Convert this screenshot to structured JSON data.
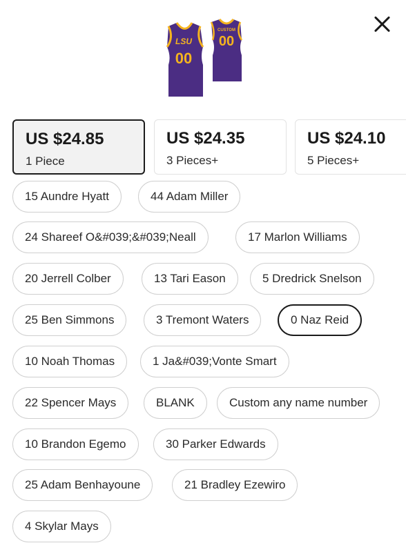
{
  "product": {
    "image_icon": "jersey-image",
    "jersey_number": "00",
    "back_text": "CUSTOM",
    "front_text": "LSU"
  },
  "pricing": [
    {
      "price": "US $24.85",
      "qty": "1 Piece",
      "selected": true
    },
    {
      "price": "US $24.35",
      "qty": "3 Pieces+",
      "selected": false
    },
    {
      "price": "US $24.10",
      "qty": "5 Pieces+",
      "selected": false
    }
  ],
  "options": [
    "15 Aundre Hyatt",
    "44 Adam Miller",
    "24 Shareef O&#039;&#039;Neall",
    "17 Marlon Williams",
    "20 Jerrell Colber",
    "13 Tari Eason",
    "5 Dredrick Snelson",
    "25 Ben Simmons",
    "3 Tremont Waters",
    "0 Naz Reid",
    "10 Noah Thomas",
    "1 Ja&#039;Vonte Smart",
    "22 Spencer Mays",
    "BLANK",
    "Custom any name number",
    "10 Brandon Egemo",
    "30 Parker Edwards",
    "25 Adam Benhayoune",
    "21 Bradley Ezewiro",
    "4 Skylar Mays"
  ],
  "selected_option": "0 Naz Reid",
  "colors": {
    "jersey_purple": "#4b2d83",
    "jersey_gold": "#f5b41e",
    "selected_border": "#1a1a1a"
  }
}
